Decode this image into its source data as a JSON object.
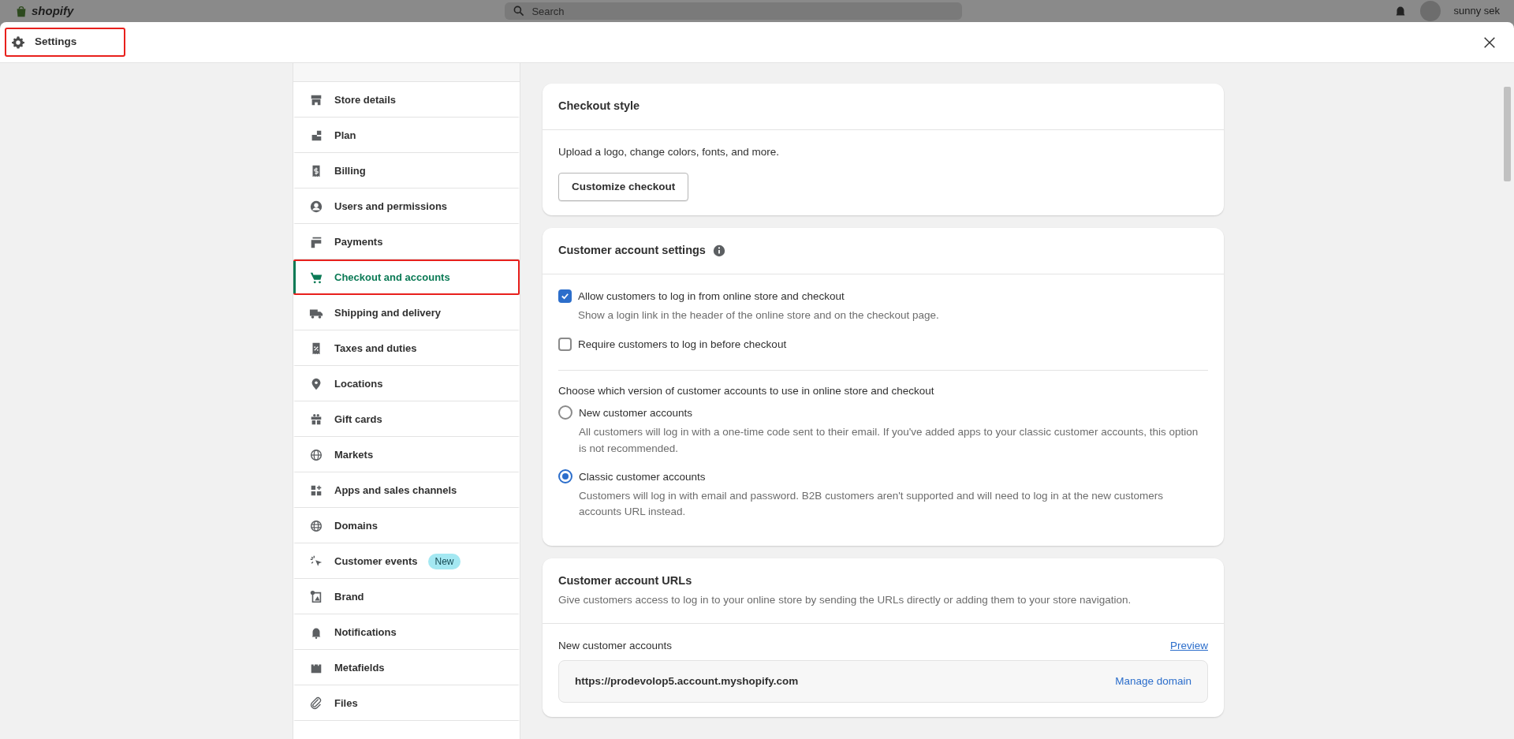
{
  "backdrop": {
    "brand": "shopify",
    "search": {
      "placeholder": "Search"
    },
    "user": "sunny sek"
  },
  "modal": {
    "title": "Settings",
    "highlighted": true
  },
  "sidebar": {
    "items": [
      {
        "label": "Store details",
        "selected": false,
        "highlighted": false
      },
      {
        "label": "Plan",
        "selected": false,
        "highlighted": false
      },
      {
        "label": "Billing",
        "selected": false,
        "highlighted": false
      },
      {
        "label": "Users and permissions",
        "selected": false,
        "highlighted": false
      },
      {
        "label": "Payments",
        "selected": false,
        "highlighted": false
      },
      {
        "label": "Checkout and accounts",
        "selected": true,
        "highlighted": true
      },
      {
        "label": "Shipping and delivery",
        "selected": false,
        "highlighted": false
      },
      {
        "label": "Taxes and duties",
        "selected": false,
        "highlighted": false
      },
      {
        "label": "Locations",
        "selected": false,
        "highlighted": false
      },
      {
        "label": "Gift cards",
        "selected": false,
        "highlighted": false
      },
      {
        "label": "Markets",
        "selected": false,
        "highlighted": false
      },
      {
        "label": "Apps and sales channels",
        "selected": false,
        "highlighted": false
      },
      {
        "label": "Domains",
        "selected": false,
        "highlighted": false
      },
      {
        "label": "Customer events",
        "badge": "New",
        "selected": false,
        "highlighted": false
      },
      {
        "label": "Brand",
        "selected": false,
        "highlighted": false
      },
      {
        "label": "Notifications",
        "selected": false,
        "highlighted": false
      },
      {
        "label": "Metafields",
        "selected": false,
        "highlighted": false
      },
      {
        "label": "Files",
        "selected": false,
        "highlighted": false
      }
    ]
  },
  "checkout_style": {
    "title": "Checkout style",
    "description": "Upload a logo, change colors, fonts, and more.",
    "button": "Customize checkout"
  },
  "account_settings": {
    "title": "Customer account settings",
    "checkboxes": [
      {
        "label": "Allow customers to log in from online store and checkout",
        "help": "Show a login link in the header of the online store and on the checkout page.",
        "checked": true
      },
      {
        "label": "Require customers to log in before checkout",
        "checked": false
      }
    ],
    "version_prompt": "Choose which version of customer accounts to use in online store and checkout",
    "radios": [
      {
        "label": "New customer accounts",
        "help": "All customers will log in with a one-time code sent to their email. If you've added apps to your classic customer accounts, this option is not recommended.",
        "selected": false
      },
      {
        "label": "Classic customer accounts",
        "help": "Customers will log in with email and password. B2B customers aren't supported and will need to log in at the new customers accounts URL instead.",
        "selected": true
      }
    ]
  },
  "account_urls": {
    "title": "Customer account URLs",
    "description": "Give customers access to log in to your online store by sending the URLs directly or adding them to your store navigation.",
    "sections": [
      {
        "label": "New customer accounts",
        "link": "Preview",
        "url": "https://prodevolop5.account.myshopify.com",
        "action": "Manage domain"
      }
    ]
  }
}
